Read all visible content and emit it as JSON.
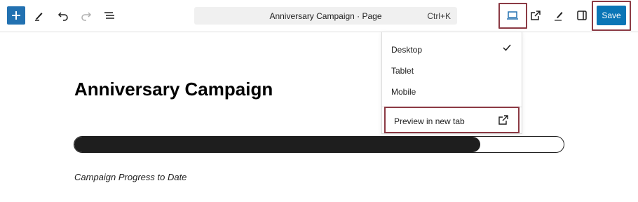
{
  "toolbar": {
    "document_title": "Anniversary Campaign · Page",
    "shortcut": "Ctrl+K",
    "save_label": "Save",
    "accent_color": "#2271b1",
    "icons": [
      "plus-icon",
      "pen-icon",
      "undo-icon",
      "redo-icon",
      "list-view-icon",
      "desktop-icon",
      "external-link-icon",
      "brush-icon",
      "sidebar-icon"
    ]
  },
  "preview_menu": {
    "items": [
      {
        "label": "Desktop",
        "checked": true
      },
      {
        "label": "Tablet",
        "checked": false
      },
      {
        "label": "Mobile",
        "checked": false
      }
    ],
    "preview_new_tab": "Preview in new tab"
  },
  "content": {
    "heading": "Anniversary Campaign",
    "progress_fraction": 0.83,
    "caption": "Campaign Progress to Date"
  },
  "highlight_color": "#8b3a44"
}
